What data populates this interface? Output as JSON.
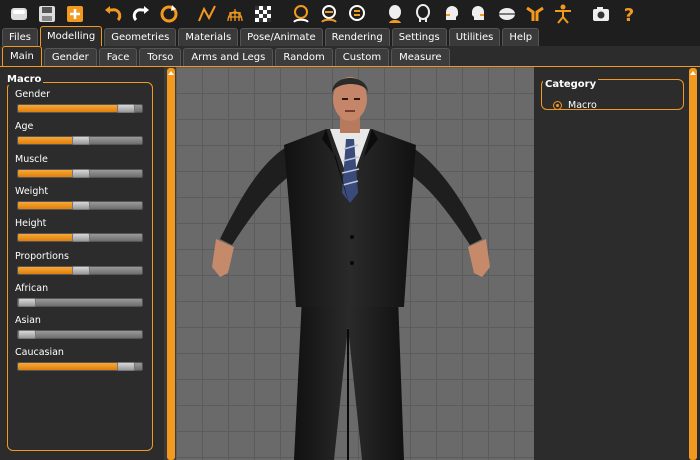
{
  "toolbar": {
    "icons": [
      "new-icon",
      "save-icon",
      "export-icon",
      "undo-icon",
      "redo-icon",
      "reset-icon",
      "smooth-icon",
      "wireframe-icon",
      "checker-icon",
      "front-view-icon",
      "back-view-icon",
      "side-view-icon",
      "head-front-icon",
      "head-back-icon",
      "head-left-icon",
      "head-right-icon",
      "head-top-icon",
      "pose-icon",
      "skeleton-icon",
      "screenshot-icon",
      "help-icon"
    ]
  },
  "main_tabs": [
    "Files",
    "Modelling",
    "Geometries",
    "Materials",
    "Pose/Animate",
    "Rendering",
    "Settings",
    "Utilities",
    "Help"
  ],
  "active_main_tab": "Modelling",
  "sub_tabs": [
    "Main",
    "Gender",
    "Face",
    "Torso",
    "Arms and Legs",
    "Random",
    "Custom",
    "Measure"
  ],
  "active_sub_tab": "Main",
  "macro": {
    "title": "Macro",
    "sliders": [
      {
        "label": "Gender",
        "value": 0.92
      },
      {
        "label": "Age",
        "value": 0.5
      },
      {
        "label": "Muscle",
        "value": 0.5
      },
      {
        "label": "Weight",
        "value": 0.5
      },
      {
        "label": "Height",
        "value": 0.5
      },
      {
        "label": "Proportions",
        "value": 0.5
      },
      {
        "label": "African",
        "value": 0.0
      },
      {
        "label": "Asian",
        "value": 0.0
      },
      {
        "label": "Caucasian",
        "value": 0.92
      }
    ]
  },
  "category": {
    "title": "Category",
    "option": "Macro"
  },
  "colors": {
    "accent": "#f29a1f"
  }
}
